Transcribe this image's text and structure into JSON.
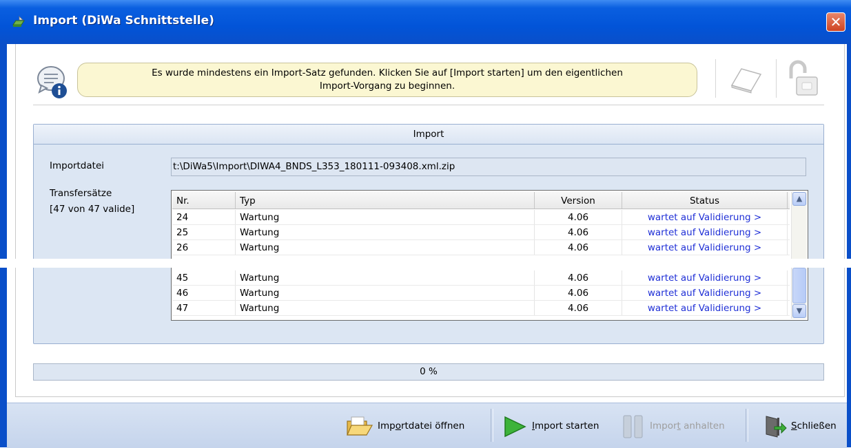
{
  "window": {
    "title": "Import (DiWa Schnittstelle)",
    "close_icon": "close-icon"
  },
  "info": {
    "icon": "info-speech-bubble-icon",
    "message_line1": "Es wurde mindestens ein Import-Satz gefunden. Klicken Sie auf [Import starten] um den eigentlichen",
    "message_line2": "Import-Vorgang zu beginnen.",
    "eraser_icon": "eraser-icon",
    "lock_icon": "unlocked-padlock-icon"
  },
  "import_group": {
    "header": "Import",
    "file_label": "Importdatei",
    "file_value": "t:\\DiWa5\\Import\\DIWA4_BNDS_L353_180111-093408.xml.zip",
    "transfer_label": "Transfersätze",
    "transfer_count": "[47 von 47 valide]"
  },
  "table": {
    "columns": [
      "Nr.",
      "Typ",
      "Version",
      "Status"
    ],
    "rows_top": [
      {
        "nr": "24",
        "typ": "Wartung",
        "version": "4.06",
        "status": "wartet auf Validierung >"
      },
      {
        "nr": "25",
        "typ": "Wartung",
        "version": "4.06",
        "status": "wartet auf Validierung >"
      },
      {
        "nr": "26",
        "typ": "Wartung",
        "version": "4.06",
        "status": "wartet auf Validierung >"
      }
    ],
    "rows_bottom": [
      {
        "nr": "45",
        "typ": "Wartung",
        "version": "4.06",
        "status": "wartet auf Validierung >"
      },
      {
        "nr": "46",
        "typ": "Wartung",
        "version": "4.06",
        "status": "wartet auf Validierung >"
      },
      {
        "nr": "47",
        "typ": "Wartung",
        "version": "4.06",
        "status": "wartet auf Validierung >"
      }
    ]
  },
  "progress": {
    "label": "0 %",
    "value": 0
  },
  "footer": {
    "open_pre": "Imp",
    "open_ul": "o",
    "open_post": "rtdatei öffnen",
    "start_ul": "I",
    "start_post": "mport starten",
    "pause_pre": "Impor",
    "pause_ul": "t",
    "pause_post": " anhalten",
    "close_ul": "S",
    "close_post": "chließen",
    "open_icon": "open-folder-icon",
    "start_icon": "play-icon",
    "pause_icon": "pause-icon",
    "close_icon": "exit-door-icon"
  },
  "colors": {
    "titlebar": "#0254d8",
    "status_link": "#1f2fd6",
    "info_bubble": "#fbf7d2",
    "group_bg": "#dce6f3"
  }
}
